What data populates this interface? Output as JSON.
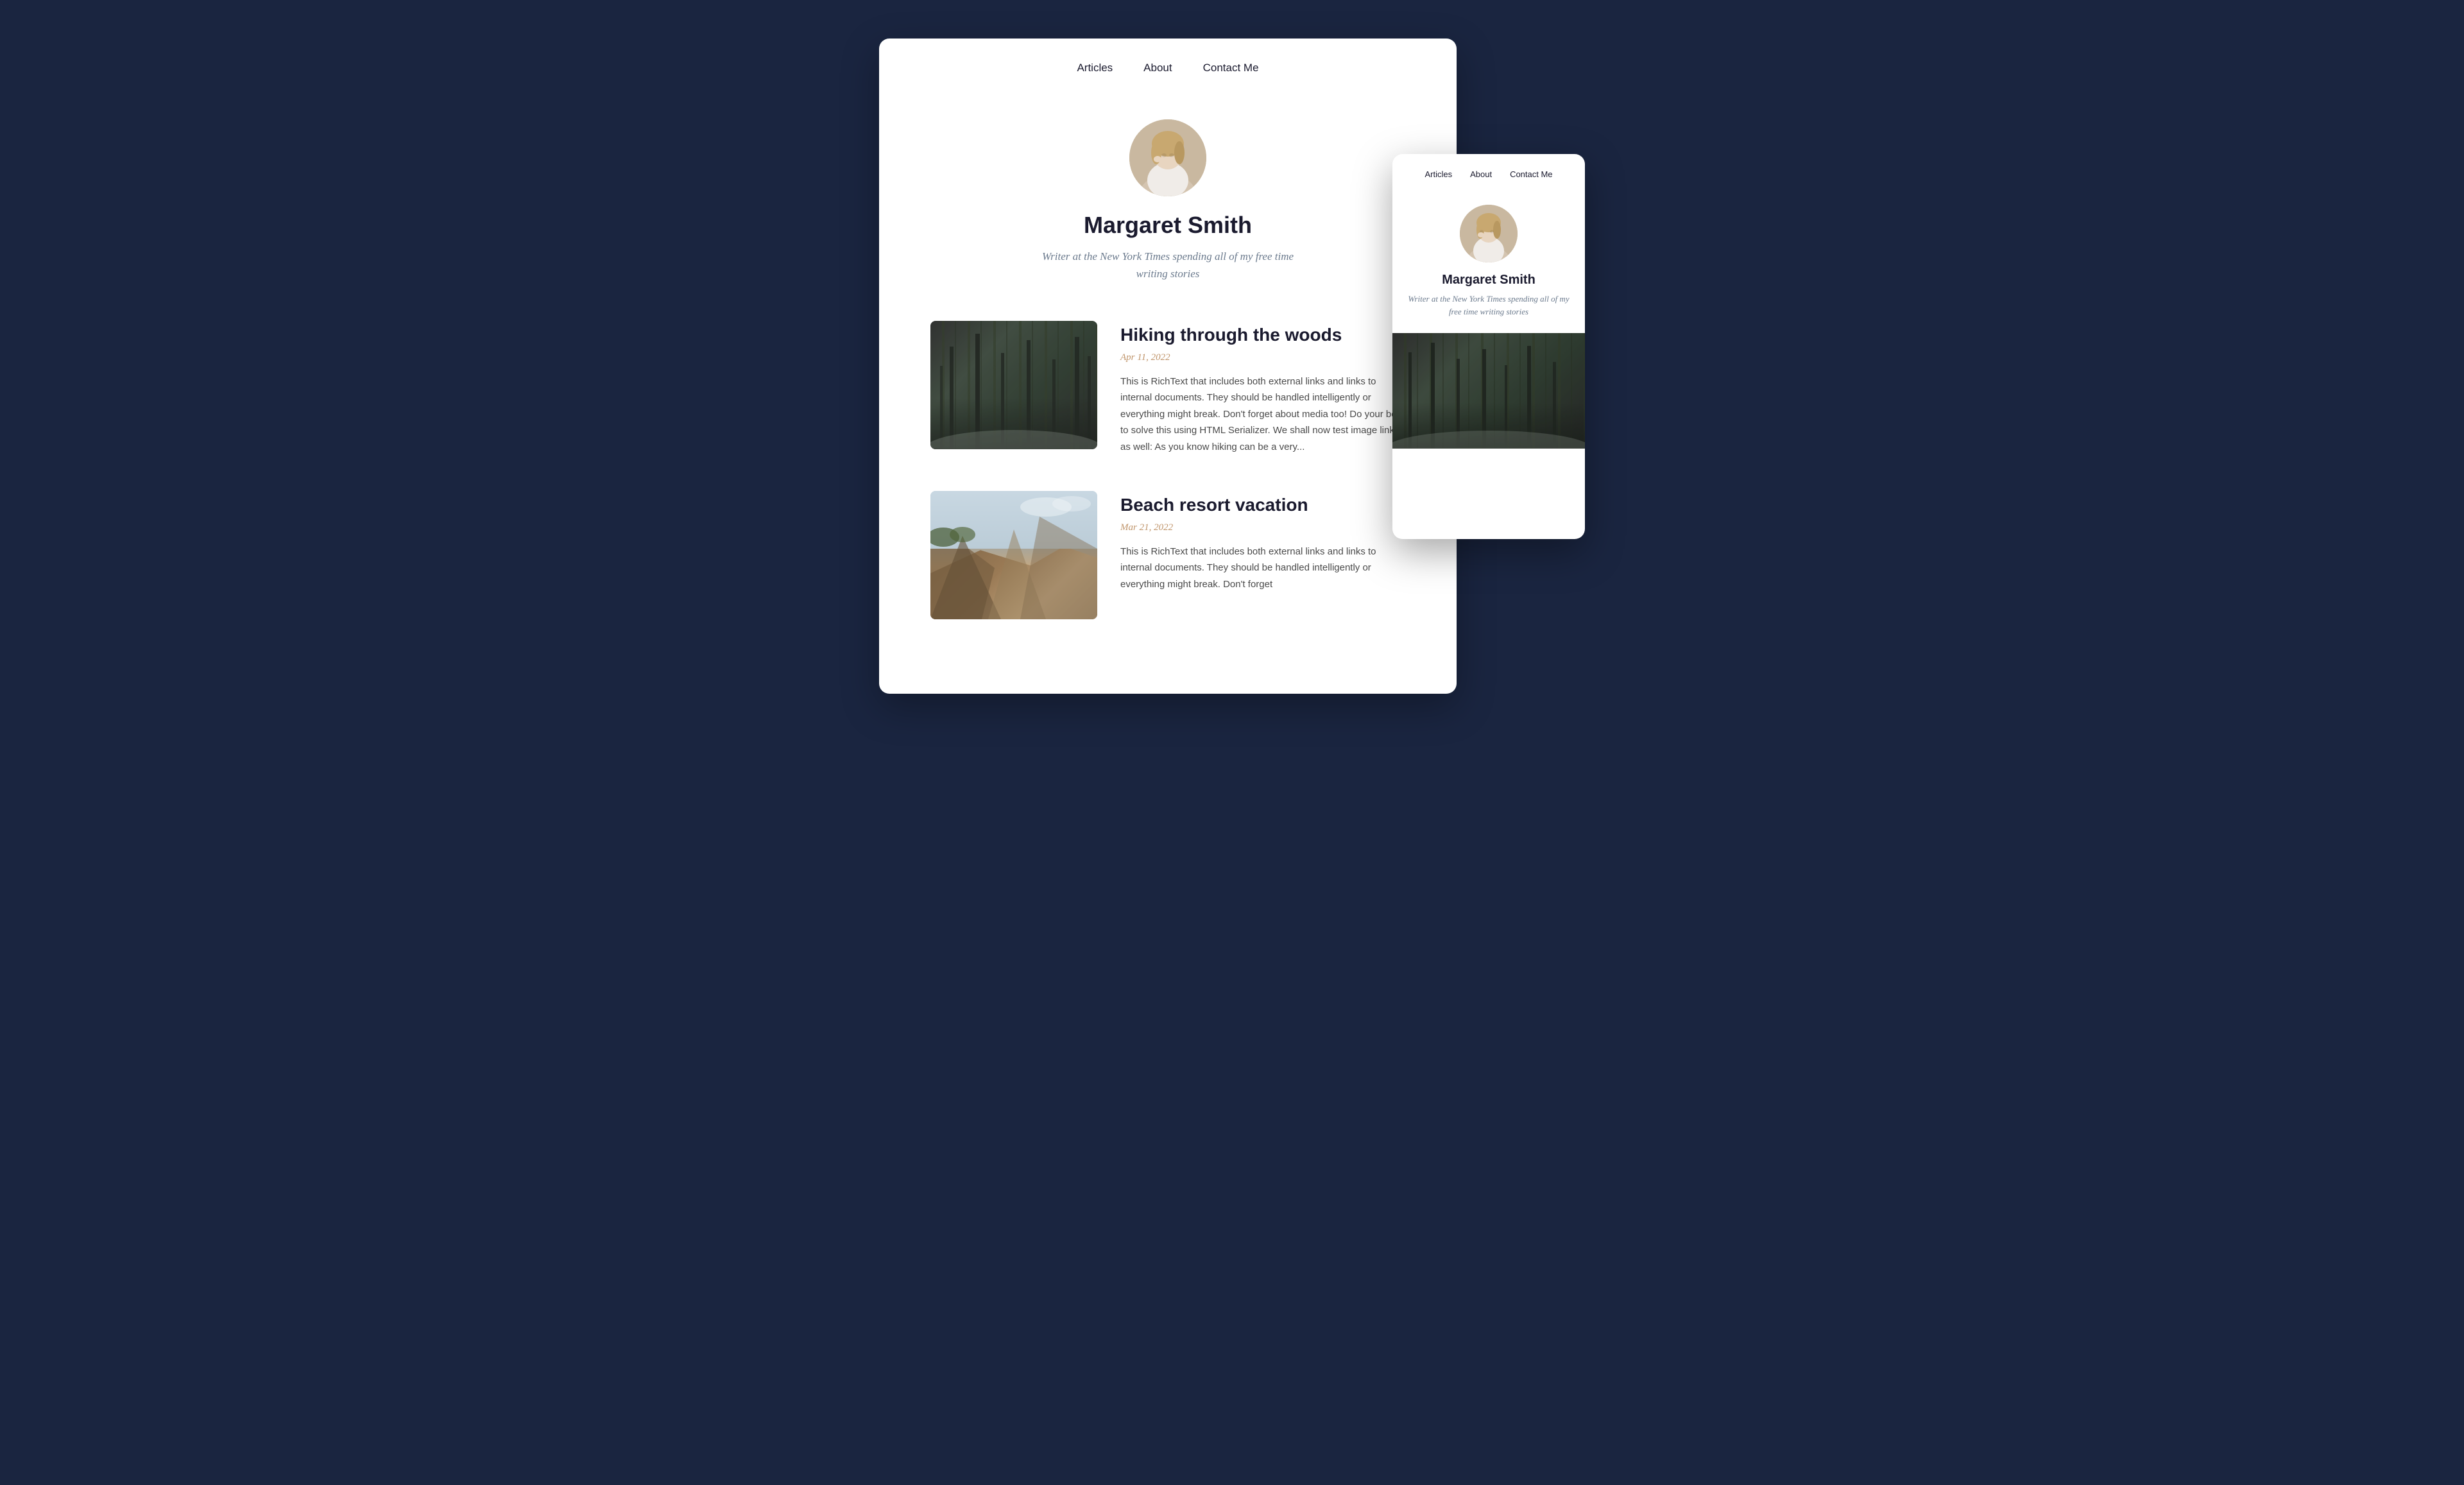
{
  "background_color": "#1a2540",
  "main_card": {
    "nav": {
      "items": [
        {
          "label": "Articles",
          "id": "articles"
        },
        {
          "label": "About",
          "id": "about"
        },
        {
          "label": "Contact Me",
          "id": "contact"
        }
      ]
    },
    "profile": {
      "name": "Margaret Smith",
      "bio": "Writer at the New York Times spending all of my free time writing stories"
    },
    "articles": [
      {
        "title": "Hiking through the woods",
        "date": "Apr 11, 2022",
        "excerpt": "This is RichText that includes both external links and links to internal documents. They should be handled intelligently or everything might break. Don't forget about media too! Do your best to solve this using HTML Serializer. We shall now test image links as well: As you know hiking can be a very...",
        "image_type": "forest"
      },
      {
        "title": "Beach resort vacation",
        "date": "Mar 21, 2022",
        "excerpt": "This is RichText that includes both external links and links to internal documents. They should be handled intelligently or everything might break. Don't forget",
        "image_type": "beach"
      }
    ]
  },
  "secondary_card": {
    "nav": {
      "items": [
        {
          "label": "Articles",
          "id": "articles"
        },
        {
          "label": "About",
          "id": "about"
        },
        {
          "label": "Contact Me",
          "id": "contact"
        }
      ]
    },
    "profile": {
      "name": "Margaret Smith",
      "bio": "Writer at the New York Times spending all of my free time writing stories"
    }
  }
}
